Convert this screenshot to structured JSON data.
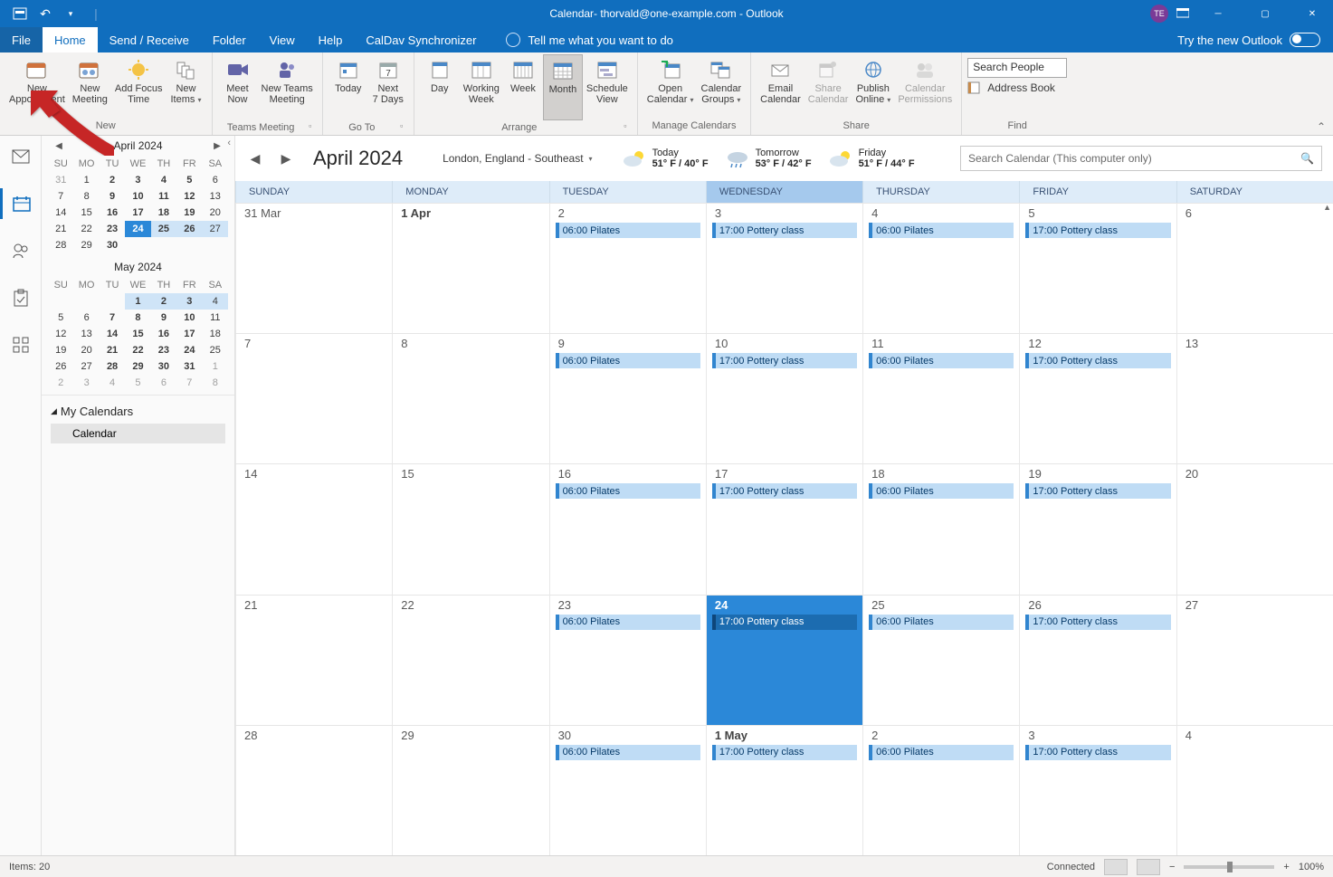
{
  "window": {
    "title": "Calendar- thorvald@one-example.com - Outlook",
    "avatar": "TE"
  },
  "tabs": {
    "file": "File",
    "home": "Home",
    "sr": "Send / Receive",
    "folder": "Folder",
    "view": "View",
    "help": "Help",
    "caldav": "CalDav Synchronizer",
    "tellme": "Tell me what you want to do",
    "trynew": "Try the new Outlook"
  },
  "ribbon": {
    "new": {
      "appt": "New\nAppointment",
      "meeting": "New\nMeeting",
      "focus": "Add Focus\nTime",
      "items": "New\nItems",
      "label": "New"
    },
    "teams": {
      "meetnow": "Meet\nNow",
      "ntm": "New Teams\nMeeting",
      "label": "Teams Meeting"
    },
    "goto": {
      "today": "Today",
      "next7": "Next\n7 Days",
      "label": "Go To"
    },
    "arrange": {
      "day": "Day",
      "workweek": "Working\nWeek",
      "week": "Week",
      "month": "Month",
      "sched": "Schedule\nView",
      "label": "Arrange"
    },
    "manage": {
      "open": "Open\nCalendar",
      "groups": "Calendar\nGroups",
      "label": "Manage Calendars"
    },
    "share": {
      "email": "Email\nCalendar",
      "sharecal": "Share\nCalendar",
      "publish": "Publish\nOnline",
      "perm": "Calendar\nPermissions",
      "label": "Share"
    },
    "find": {
      "search": "Search People",
      "ab": "Address Book",
      "label": "Find"
    }
  },
  "sidebar": {
    "month1": {
      "title": "April 2024",
      "dh": [
        "SU",
        "MO",
        "TU",
        "WE",
        "TH",
        "FR",
        "SA"
      ],
      "rows": [
        [
          {
            "v": "31",
            "o": 1
          },
          {
            "v": "1"
          },
          {
            "v": "2",
            "b": 1
          },
          {
            "v": "3",
            "b": 1
          },
          {
            "v": "4",
            "b": 1
          },
          {
            "v": "5",
            "b": 1
          },
          {
            "v": "6"
          }
        ],
        [
          {
            "v": "7"
          },
          {
            "v": "8"
          },
          {
            "v": "9",
            "b": 1
          },
          {
            "v": "10",
            "b": 1
          },
          {
            "v": "11",
            "b": 1
          },
          {
            "v": "12",
            "b": 1
          },
          {
            "v": "13"
          }
        ],
        [
          {
            "v": "14"
          },
          {
            "v": "15"
          },
          {
            "v": "16",
            "b": 1
          },
          {
            "v": "17",
            "b": 1
          },
          {
            "v": "18",
            "b": 1
          },
          {
            "v": "19",
            "b": 1
          },
          {
            "v": "20"
          }
        ],
        [
          {
            "v": "21"
          },
          {
            "v": "22"
          },
          {
            "v": "23",
            "b": 1
          },
          {
            "v": "24",
            "t": 1
          },
          {
            "v": "25",
            "b": 1,
            "bz": 1
          },
          {
            "v": "26",
            "b": 1,
            "bz": 1
          },
          {
            "v": "27",
            "bz": 1
          }
        ],
        [
          {
            "v": "28"
          },
          {
            "v": "29"
          },
          {
            "v": "30",
            "b": 1
          },
          {
            "v": ""
          },
          {
            "v": ""
          },
          {
            "v": ""
          },
          {
            "v": ""
          }
        ]
      ]
    },
    "month2": {
      "title": "May 2024",
      "dh": [
        "SU",
        "MO",
        "TU",
        "WE",
        "TH",
        "FR",
        "SA"
      ],
      "rows": [
        [
          {
            "v": ""
          },
          {
            "v": ""
          },
          {
            "v": ""
          },
          {
            "v": "1",
            "b": 1,
            "bz": 1
          },
          {
            "v": "2",
            "b": 1,
            "bz": 1
          },
          {
            "v": "3",
            "b": 1,
            "bz": 1
          },
          {
            "v": "4",
            "bz": 1
          }
        ],
        [
          {
            "v": "5"
          },
          {
            "v": "6"
          },
          {
            "v": "7",
            "b": 1
          },
          {
            "v": "8",
            "b": 1
          },
          {
            "v": "9",
            "b": 1
          },
          {
            "v": "10",
            "b": 1
          },
          {
            "v": "11"
          }
        ],
        [
          {
            "v": "12"
          },
          {
            "v": "13"
          },
          {
            "v": "14",
            "b": 1
          },
          {
            "v": "15",
            "b": 1
          },
          {
            "v": "16",
            "b": 1
          },
          {
            "v": "17",
            "b": 1
          },
          {
            "v": "18"
          }
        ],
        [
          {
            "v": "19"
          },
          {
            "v": "20"
          },
          {
            "v": "21",
            "b": 1
          },
          {
            "v": "22",
            "b": 1
          },
          {
            "v": "23",
            "b": 1
          },
          {
            "v": "24",
            "b": 1
          },
          {
            "v": "25"
          }
        ],
        [
          {
            "v": "26"
          },
          {
            "v": "27"
          },
          {
            "v": "28",
            "b": 1
          },
          {
            "v": "29",
            "b": 1
          },
          {
            "v": "30",
            "b": 1
          },
          {
            "v": "31",
            "b": 1
          },
          {
            "v": "1",
            "o": 1
          }
        ],
        [
          {
            "v": "2",
            "o": 1
          },
          {
            "v": "3",
            "o": 1
          },
          {
            "v": "4",
            "o": 1
          },
          {
            "v": "5",
            "o": 1
          },
          {
            "v": "6",
            "o": 1
          },
          {
            "v": "7",
            "o": 1
          },
          {
            "v": "8",
            "o": 1
          }
        ]
      ]
    },
    "myCals": "My Calendars",
    "calItem": "Calendar"
  },
  "main": {
    "month": "April 2024",
    "loc": "London, England - Southeast",
    "wx": [
      {
        "day": "Today",
        "t": "51° F / 40° F"
      },
      {
        "day": "Tomorrow",
        "t": "53° F / 42° F"
      },
      {
        "day": "Friday",
        "t": "51° F / 44° F"
      }
    ],
    "search": "Search Calendar (This computer only)",
    "days": [
      "SUNDAY",
      "MONDAY",
      "TUESDAY",
      "WEDNESDAY",
      "THURSDAY",
      "FRIDAY",
      "SATURDAY"
    ],
    "weeks": [
      [
        {
          "n": "31 Mar"
        },
        {
          "n": "1 Apr",
          "b": 1
        },
        {
          "n": "2",
          "e": [
            "06:00 Pilates"
          ]
        },
        {
          "n": "3",
          "e": [
            "17:00 Pottery class"
          ]
        },
        {
          "n": "4",
          "e": [
            "06:00 Pilates"
          ]
        },
        {
          "n": "5",
          "e": [
            "17:00 Pottery class"
          ]
        },
        {
          "n": "6"
        }
      ],
      [
        {
          "n": "7"
        },
        {
          "n": "8"
        },
        {
          "n": "9",
          "e": [
            "06:00 Pilates"
          ]
        },
        {
          "n": "10",
          "e": [
            "17:00 Pottery class"
          ]
        },
        {
          "n": "11",
          "e": [
            "06:00 Pilates"
          ]
        },
        {
          "n": "12",
          "e": [
            "17:00 Pottery class"
          ]
        },
        {
          "n": "13"
        }
      ],
      [
        {
          "n": "14"
        },
        {
          "n": "15"
        },
        {
          "n": "16",
          "e": [
            "06:00 Pilates"
          ]
        },
        {
          "n": "17",
          "e": [
            "17:00 Pottery class"
          ]
        },
        {
          "n": "18",
          "e": [
            "06:00 Pilates"
          ]
        },
        {
          "n": "19",
          "e": [
            "17:00 Pottery class"
          ]
        },
        {
          "n": "20"
        }
      ],
      [
        {
          "n": "21"
        },
        {
          "n": "22"
        },
        {
          "n": "23",
          "e": [
            "06:00 Pilates"
          ]
        },
        {
          "n": "24",
          "today": 1,
          "b": 1,
          "e": [
            "17:00 Pottery class"
          ]
        },
        {
          "n": "25",
          "e": [
            "06:00 Pilates"
          ]
        },
        {
          "n": "26",
          "e": [
            "17:00 Pottery class"
          ]
        },
        {
          "n": "27"
        }
      ],
      [
        {
          "n": "28"
        },
        {
          "n": "29"
        },
        {
          "n": "30",
          "e": [
            "06:00 Pilates"
          ]
        },
        {
          "n": "1 May",
          "b": 1,
          "e": [
            "17:00 Pottery class"
          ]
        },
        {
          "n": "2",
          "e": [
            "06:00 Pilates"
          ]
        },
        {
          "n": "3",
          "e": [
            "17:00 Pottery class"
          ]
        },
        {
          "n": "4"
        }
      ]
    ]
  },
  "status": {
    "items": "Items: 20",
    "conn": "Connected",
    "zoom": "100%"
  }
}
